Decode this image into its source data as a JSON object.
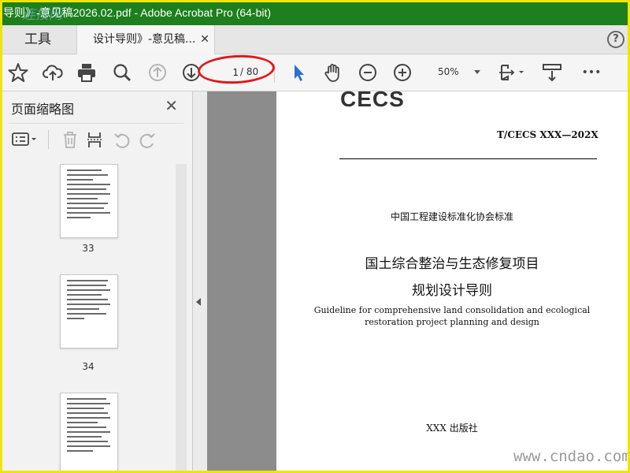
{
  "window": {
    "title": "导则》-意见稿2026.02.pdf - Adobe Acrobat Pro (64-bit)",
    "watermark": "连接网"
  },
  "tabs": {
    "tools_label": "工具",
    "doc_label": "设计导则》-意见稿...",
    "close_glyph": "✕",
    "help_glyph": "?"
  },
  "toolbar": {
    "page_current": "1",
    "page_total": "/ 80",
    "zoom_value": "50%",
    "more_glyph": "•••"
  },
  "sidebar": {
    "title": "页面缩略图",
    "close_glyph": "✕",
    "thumbnails": [
      {
        "label": "33"
      },
      {
        "label": "34"
      },
      {
        "label": ""
      }
    ]
  },
  "document": {
    "logo_text": "CECS",
    "standard_code": "T/CECS XXX—202X",
    "association": "中国工程建设标准化协会标准",
    "title_line1": "国土综合整治与生态修复项目",
    "title_line2": "规划设计导则",
    "english_line1": "Guideline for comprehensive land consolidation and ecological",
    "english_line2": "restoration project planning and design",
    "publisher": "XXX 出版社"
  },
  "site_watermark": "www.cndao.com",
  "colors": {
    "titlebar": "#1d7f1d",
    "frame": "#f2e400",
    "annotation": "#e01a1a",
    "select_tool": "#2a6fd6"
  }
}
